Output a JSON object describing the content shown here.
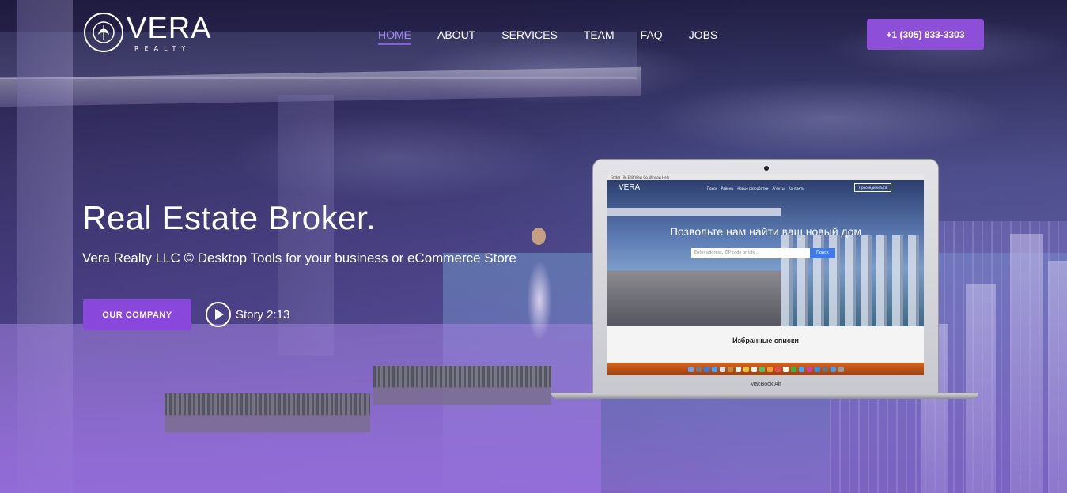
{
  "brand": {
    "name": "VERA",
    "tagline": "REALTY"
  },
  "nav": {
    "items": [
      {
        "label": "HOME",
        "active": true
      },
      {
        "label": "ABOUT",
        "active": false
      },
      {
        "label": "SERVICES",
        "active": false
      },
      {
        "label": "TEAM",
        "active": false
      },
      {
        "label": "FAQ",
        "active": false
      },
      {
        "label": "JOBS",
        "active": false
      }
    ]
  },
  "header": {
    "phone_label": "+1 (305) 833-3303"
  },
  "hero": {
    "title": "Real Estate Broker.",
    "subtitle": "Vera Realty LLC © Desktop Tools for your business or eCommerce Store",
    "cta_label": "OUR COMPANY",
    "story_label": "Story 2:13"
  },
  "laptop": {
    "model": "MacBook Air",
    "menubar": "Finder   File   Edit   View   Go   Window   Help",
    "site": {
      "logo": "VERA",
      "nav": [
        "Поиск",
        "Районы",
        "Новые разработки",
        "Агенты",
        "Контакты"
      ],
      "button": "Присоединиться",
      "headline": "Позвольте нам найти ваш новый дом",
      "search_placeholder": "Enter address, ZIP code or city...",
      "search_button": "Поиск",
      "section_title": "Избранные списки"
    }
  },
  "colors": {
    "accent": "#8e4fd8",
    "nav_active": "#a98cf2"
  }
}
